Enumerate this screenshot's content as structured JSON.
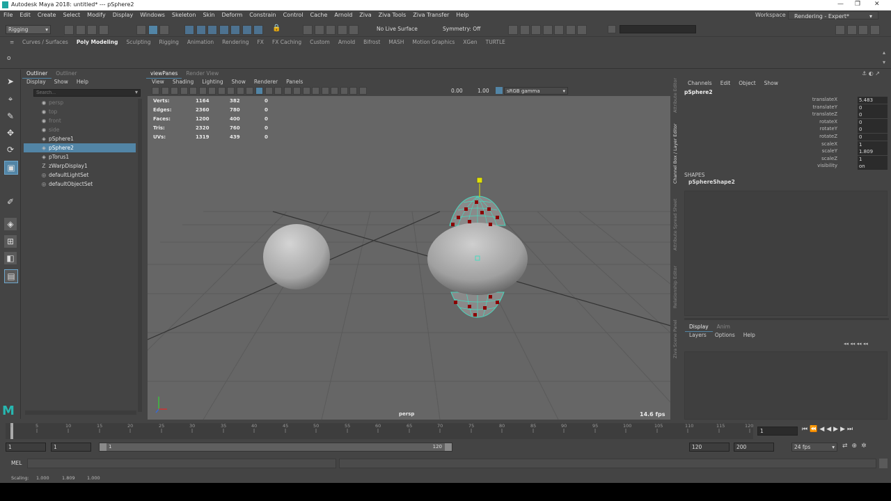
{
  "window": {
    "title": "Autodesk Maya 2018: untitled*   ---   pSphere2",
    "min": "—",
    "max": "❐",
    "close": "✕"
  },
  "menubar": [
    "File",
    "Edit",
    "Create",
    "Select",
    "Modify",
    "Display",
    "Windows",
    "Skeleton",
    "Skin",
    "Deform",
    "Constrain",
    "Control",
    "Cache",
    "Arnold",
    "Ziva",
    "Ziva Tools",
    "Ziva Transfer",
    "Help"
  ],
  "workspace": {
    "label": "Workspace :",
    "value": "Rendering - Expert*"
  },
  "statusline": {
    "menuset": "Rigging",
    "live_surface": "No Live Surface",
    "symmetry": "Symmetry: Off"
  },
  "shelf_tabs": [
    "Curves / Surfaces",
    "Poly Modeling",
    "Sculpting",
    "Rigging",
    "Animation",
    "Rendering",
    "FX",
    "FX Caching",
    "Custom",
    "Arnold",
    "Bifrost",
    "MASH",
    "Motion Graphics",
    "XGen",
    "TURTLE"
  ],
  "shelf_active": "Poly Modeling",
  "outliner": {
    "tabs": [
      "Outliner",
      "Outliner"
    ],
    "menu": [
      "Display",
      "Show",
      "Help"
    ],
    "search_placeholder": "Search...",
    "items": [
      {
        "label": "persp",
        "dim": true,
        "icon": "camera"
      },
      {
        "label": "top",
        "dim": true,
        "icon": "camera"
      },
      {
        "label": "front",
        "dim": true,
        "icon": "camera"
      },
      {
        "label": "side",
        "dim": true,
        "icon": "camera"
      },
      {
        "label": "pSphere1",
        "dim": false,
        "icon": "mesh"
      },
      {
        "label": "pSphere2",
        "dim": false,
        "icon": "mesh",
        "selected": true
      },
      {
        "label": "pTorus1",
        "dim": false,
        "icon": "mesh"
      },
      {
        "label": "zWarpDisplay1",
        "dim": false,
        "icon": "ziva"
      },
      {
        "label": "defaultLightSet",
        "dim": false,
        "icon": "set"
      },
      {
        "label": "defaultObjectSet",
        "dim": false,
        "icon": "set"
      }
    ]
  },
  "viewport": {
    "tabs": [
      "viewPanes",
      "Render View"
    ],
    "menu": [
      "View",
      "Shading",
      "Lighting",
      "Show",
      "Renderer",
      "Panels"
    ],
    "exposure": "0.00",
    "gamma": "1.00",
    "colorspace": "sRGB gamma",
    "hud": [
      {
        "label": "Verts:",
        "a": "1164",
        "b": "382",
        "c": "0"
      },
      {
        "label": "Edges:",
        "a": "2360",
        "b": "780",
        "c": "0"
      },
      {
        "label": "Faces:",
        "a": "1200",
        "b": "400",
        "c": "0"
      },
      {
        "label": "Tris:",
        "a": "2320",
        "b": "760",
        "c": "0"
      },
      {
        "label": "UVs:",
        "a": "1319",
        "b": "439",
        "c": "0"
      }
    ],
    "camera": "persp",
    "fps": "14.6 fps"
  },
  "channel_box": {
    "menu": [
      "Channels",
      "Edit",
      "Object",
      "Show"
    ],
    "object": "pSphere2",
    "channels": [
      {
        "label": "translateX",
        "value": "5.483"
      },
      {
        "label": "translateY",
        "value": "0"
      },
      {
        "label": "translateZ",
        "value": "0"
      },
      {
        "label": "rotateX",
        "value": "0"
      },
      {
        "label": "rotateY",
        "value": "0"
      },
      {
        "label": "rotateZ",
        "value": "0"
      },
      {
        "label": "scaleX",
        "value": "1"
      },
      {
        "label": "scaleY",
        "value": "1.809"
      },
      {
        "label": "scaleZ",
        "value": "1"
      },
      {
        "label": "visibility",
        "value": "on"
      }
    ],
    "shapes_label": "SHAPES",
    "shape": "pSphereShape2",
    "side_tabs": [
      "Attribute Editor",
      "Channel Box / Layer Editor",
      "Attribute Spread Sheet",
      "Relationship Editor",
      "Ziva Scene Panel"
    ]
  },
  "layer_editor": {
    "tabs": [
      "Display",
      "Anim"
    ],
    "menu": [
      "Layers",
      "Options",
      "Help"
    ]
  },
  "timeline": {
    "ticks": [
      "1",
      "5",
      "10",
      "15",
      "20",
      "25",
      "30",
      "35",
      "40",
      "45",
      "50",
      "55",
      "60",
      "65",
      "70",
      "75",
      "80",
      "85",
      "90",
      "95",
      "100",
      "105",
      "110",
      "115",
      "120"
    ],
    "current_frame": "1"
  },
  "range": {
    "start": "1",
    "playback_start": "1",
    "slider_start": "1",
    "slider_end": "120",
    "playback_end": "120",
    "end": "200",
    "fps": "24 fps"
  },
  "cmdline": {
    "label": "MEL"
  },
  "helpline": {
    "text": "Scaling:",
    "v1": "1.000",
    "v2": "1.809",
    "v3": "1.000"
  },
  "colors": {
    "selection": "#5285a6",
    "wire": "#47d9bf",
    "vertex": "#8b0000",
    "bg": "#444444",
    "viewport": "#666666"
  }
}
